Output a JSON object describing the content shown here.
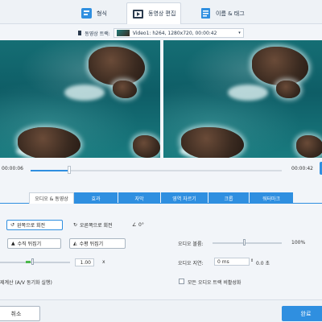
{
  "tabs": [
    {
      "label": "형식",
      "icon": "format-icon"
    },
    {
      "label": "동영상 편집",
      "icon": "video-edit-icon"
    },
    {
      "label": "이름 & 태그",
      "icon": "tag-icon"
    }
  ],
  "video_select": {
    "label": "동영상 트랙:",
    "value": "Video1: h264, 1280x720, 00:00:42"
  },
  "timeline": {
    "current": "00:00:06",
    "total": "00:00:42",
    "progress": 0.15
  },
  "edit_tabs": [
    "오디오 & 동영상",
    "효과",
    "자막",
    "영역 자르기",
    "크롭",
    "워터마크"
  ],
  "controls": {
    "rotate_left": "왼쪽으로 회전",
    "rotate_right": "오른쪽으로 회전",
    "angle": "0°",
    "flip_v": "수직 뒤집기",
    "flip_h": "수평 뒤집기",
    "speed_value": "1.00",
    "speed_unit": "x",
    "volume_label": "오디오 볼륨:",
    "volume_value": "100%",
    "delay_label": "오디오 지연:",
    "delay_input": "0 ms",
    "delay_sec": "0.0 초",
    "resample_label": "제계산 (A/V 동기화 실행)",
    "normalize_label": "모든 오디오 트랙 비활성화"
  },
  "footer": {
    "cancel": "취소",
    "ok": "완료"
  },
  "colors": {
    "accent": "#2f8fe0"
  }
}
